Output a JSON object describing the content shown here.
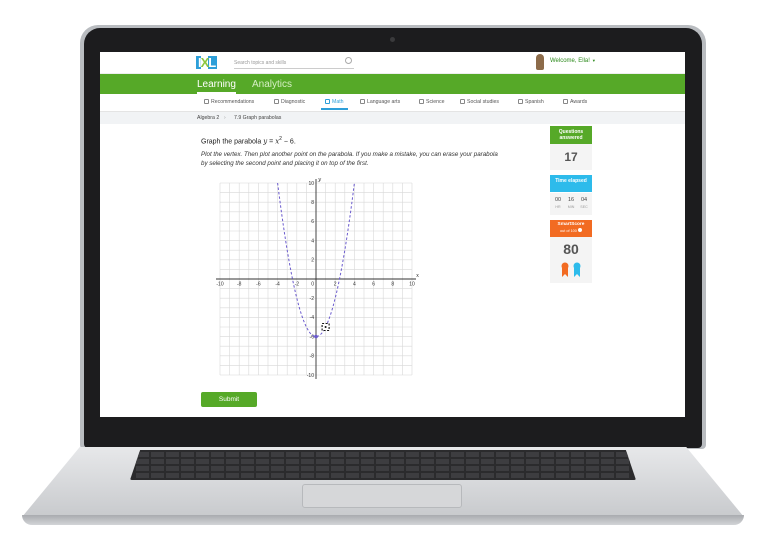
{
  "header": {
    "search_placeholder": "Search topics and skills",
    "welcome": "Welcome, Ella!",
    "tabs": [
      {
        "label": "Learning",
        "active": true
      },
      {
        "label": "Analytics",
        "active": false
      }
    ]
  },
  "subnav": [
    {
      "label": "Recommendations",
      "icon": "recommendations-icon"
    },
    {
      "label": "Diagnostic",
      "icon": "diagnostic-icon"
    },
    {
      "label": "Math",
      "icon": "math-icon",
      "active": true
    },
    {
      "label": "Language arts",
      "icon": "language-arts-icon"
    },
    {
      "label": "Science",
      "icon": "science-icon"
    },
    {
      "label": "Social studies",
      "icon": "social-studies-icon"
    },
    {
      "label": "Spanish",
      "icon": "spanish-icon"
    },
    {
      "label": "Awards",
      "icon": "awards-icon"
    }
  ],
  "breadcrumb": {
    "course": "Algebra 2",
    "skill": "7.9 Graph parabolas"
  },
  "question": {
    "prefix": "Graph the parabola ",
    "equation_y": "y",
    "equation_eq": " = ",
    "equation_x": "x",
    "equation_exp": "2",
    "equation_rest": " − 6.",
    "instructions": "Plot the vertex. Then plot another point on the parabola. If you make a mistake, you can erase your parabola by selecting the second point and placing it on top of the first."
  },
  "graph": {
    "x_label": "x",
    "y_label": "y",
    "x_ticks": [
      "-10",
      "-8",
      "-6",
      "-4",
      "-2",
      "2",
      "4",
      "6",
      "8",
      "10"
    ],
    "y_ticks": [
      "10",
      "8",
      "6",
      "4",
      "2",
      "-2",
      "-4",
      "-6",
      "-8",
      "-10"
    ],
    "origin_label": "0",
    "xlim": [
      -10,
      10
    ],
    "ylim": [
      -10,
      10
    ],
    "curve": {
      "a": 1,
      "h": 0,
      "k": -6,
      "style": "dashed",
      "color": "#6a5acd"
    },
    "vertex": [
      0,
      -6
    ],
    "cursor_point": [
      1,
      -5
    ]
  },
  "submit_label": "Submit",
  "stats": {
    "questions_label": "Questions answered",
    "questions_value": "17",
    "time_label": "Time elapsed",
    "time": [
      {
        "value": "00",
        "unit": "HR"
      },
      {
        "value": "16",
        "unit": "MIN"
      },
      {
        "value": "04",
        "unit": "SEC"
      }
    ],
    "smartscore_label": "SmartScore",
    "smartscore_sub": "out of 100",
    "smartscore_value": "80"
  },
  "colors": {
    "ixl_green": "#56a928",
    "ixl_blue": "#2d9fd9",
    "time_blue": "#2dbbeb",
    "smartscore_orange": "#f26b22"
  }
}
